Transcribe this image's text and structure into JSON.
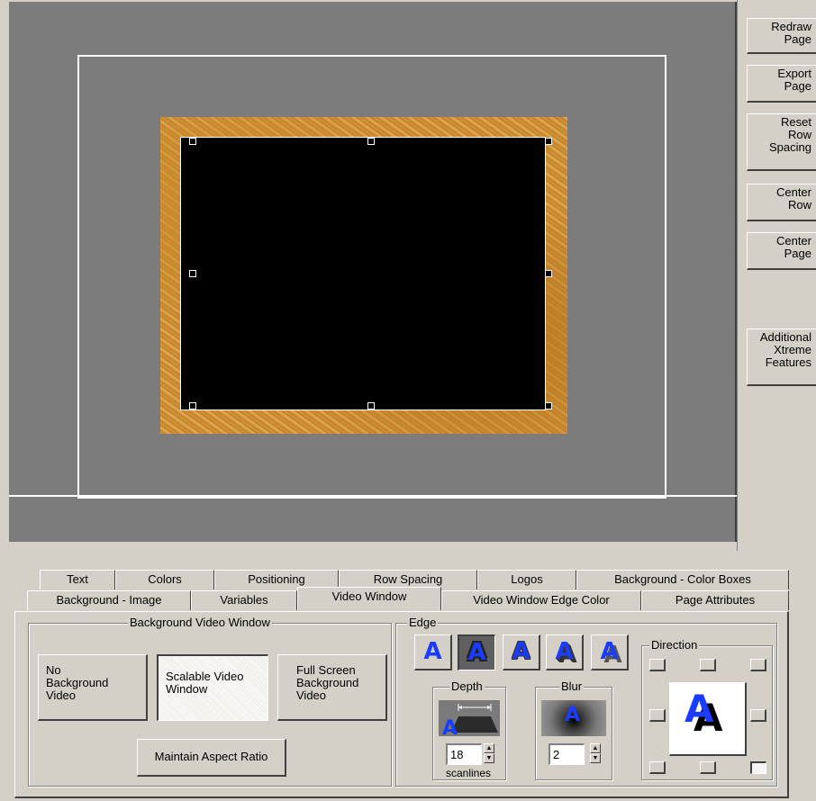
{
  "toolbar": {
    "redraw_page": "Redraw\nPage",
    "export_page": "Export\nPage",
    "reset_row_spacing": "Reset\nRow\nSpacing",
    "center_row": "Center\nRow",
    "center_page": "Center\nPage",
    "additional_features": "Additional\nXtreme\nFeatures"
  },
  "tabs": {
    "row1": [
      "Text",
      "Colors",
      "Positioning",
      "Row Spacing",
      "Logos",
      "Background - Color Boxes"
    ],
    "row2": [
      "Background - Image",
      "Variables",
      "Video Window",
      "Video Window Edge Color",
      "Page Attributes"
    ],
    "active": "Video Window"
  },
  "background_video_window": {
    "title": "Background Video Window",
    "no_background_video": "No\nBackground\nVideo",
    "scalable_video_window": "Scalable Video\nWindow",
    "full_screen_background_video": "Full Screen\nBackground\nVideo",
    "maintain_aspect_ratio": "Maintain Aspect Ratio",
    "selected": "Scalable Video Window"
  },
  "edge": {
    "title": "Edge",
    "style_glyph": "A",
    "selected_style_index": 1,
    "depth": {
      "title": "Depth",
      "value": "18",
      "unit": "scanlines"
    },
    "blur": {
      "title": "Blur",
      "value": "2"
    },
    "direction": {
      "title": "Direction",
      "preview_glyph": "A",
      "selected": "bottom-right"
    }
  },
  "colors": {
    "canvas_bg": "#7c7c7c",
    "video_window": "#000000",
    "glyph_blue": "#1a3cff",
    "frame_texture": "#cf9338"
  }
}
